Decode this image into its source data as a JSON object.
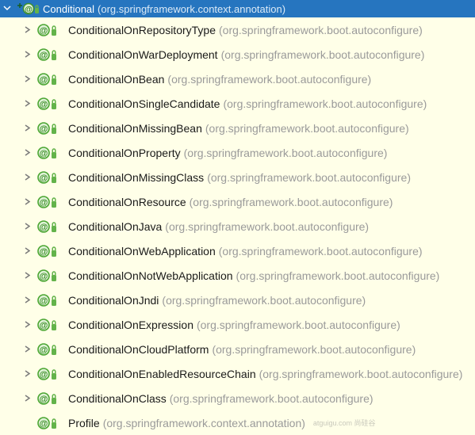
{
  "root": {
    "name": "Conditional",
    "package": "(org.springframework.context.annotation)"
  },
  "items": [
    {
      "name": "ConditionalOnRepositoryType",
      "package": "(org.springframework.boot.autoconfigure)",
      "expandable": true
    },
    {
      "name": "ConditionalOnWarDeployment",
      "package": "(org.springframework.boot.autoconfigure)",
      "expandable": true
    },
    {
      "name": "ConditionalOnBean",
      "package": "(org.springframework.boot.autoconfigure)",
      "expandable": true
    },
    {
      "name": "ConditionalOnSingleCandidate",
      "package": "(org.springframework.boot.autoconfigure)",
      "expandable": true
    },
    {
      "name": "ConditionalOnMissingBean",
      "package": "(org.springframework.boot.autoconfigure)",
      "expandable": true
    },
    {
      "name": "ConditionalOnProperty",
      "package": "(org.springframework.boot.autoconfigure)",
      "expandable": true
    },
    {
      "name": "ConditionalOnMissingClass",
      "package": "(org.springframework.boot.autoconfigure)",
      "expandable": true
    },
    {
      "name": "ConditionalOnResource",
      "package": "(org.springframework.boot.autoconfigure)",
      "expandable": true
    },
    {
      "name": "ConditionalOnJava",
      "package": "(org.springframework.boot.autoconfigure)",
      "expandable": true
    },
    {
      "name": "ConditionalOnWebApplication",
      "package": "(org.springframework.boot.autoconfigure)",
      "expandable": true
    },
    {
      "name": "ConditionalOnNotWebApplication",
      "package": "(org.springframework.boot.autoconfigure)",
      "expandable": true
    },
    {
      "name": "ConditionalOnJndi",
      "package": "(org.springframework.boot.autoconfigure)",
      "expandable": true
    },
    {
      "name": "ConditionalOnExpression",
      "package": "(org.springframework.boot.autoconfigure)",
      "expandable": true
    },
    {
      "name": "ConditionalOnCloudPlatform",
      "package": "(org.springframework.boot.autoconfigure)",
      "expandable": true
    },
    {
      "name": "ConditionalOnEnabledResourceChain",
      "package": "(org.springframework.boot.autoconfigure)",
      "expandable": true
    },
    {
      "name": "ConditionalOnClass",
      "package": "(org.springframework.boot.autoconfigure)",
      "expandable": true
    },
    {
      "name": "Profile",
      "package": "(org.springframework.context.annotation)",
      "expandable": false
    }
  ],
  "watermark": "atguigu.com 尚硅谷"
}
